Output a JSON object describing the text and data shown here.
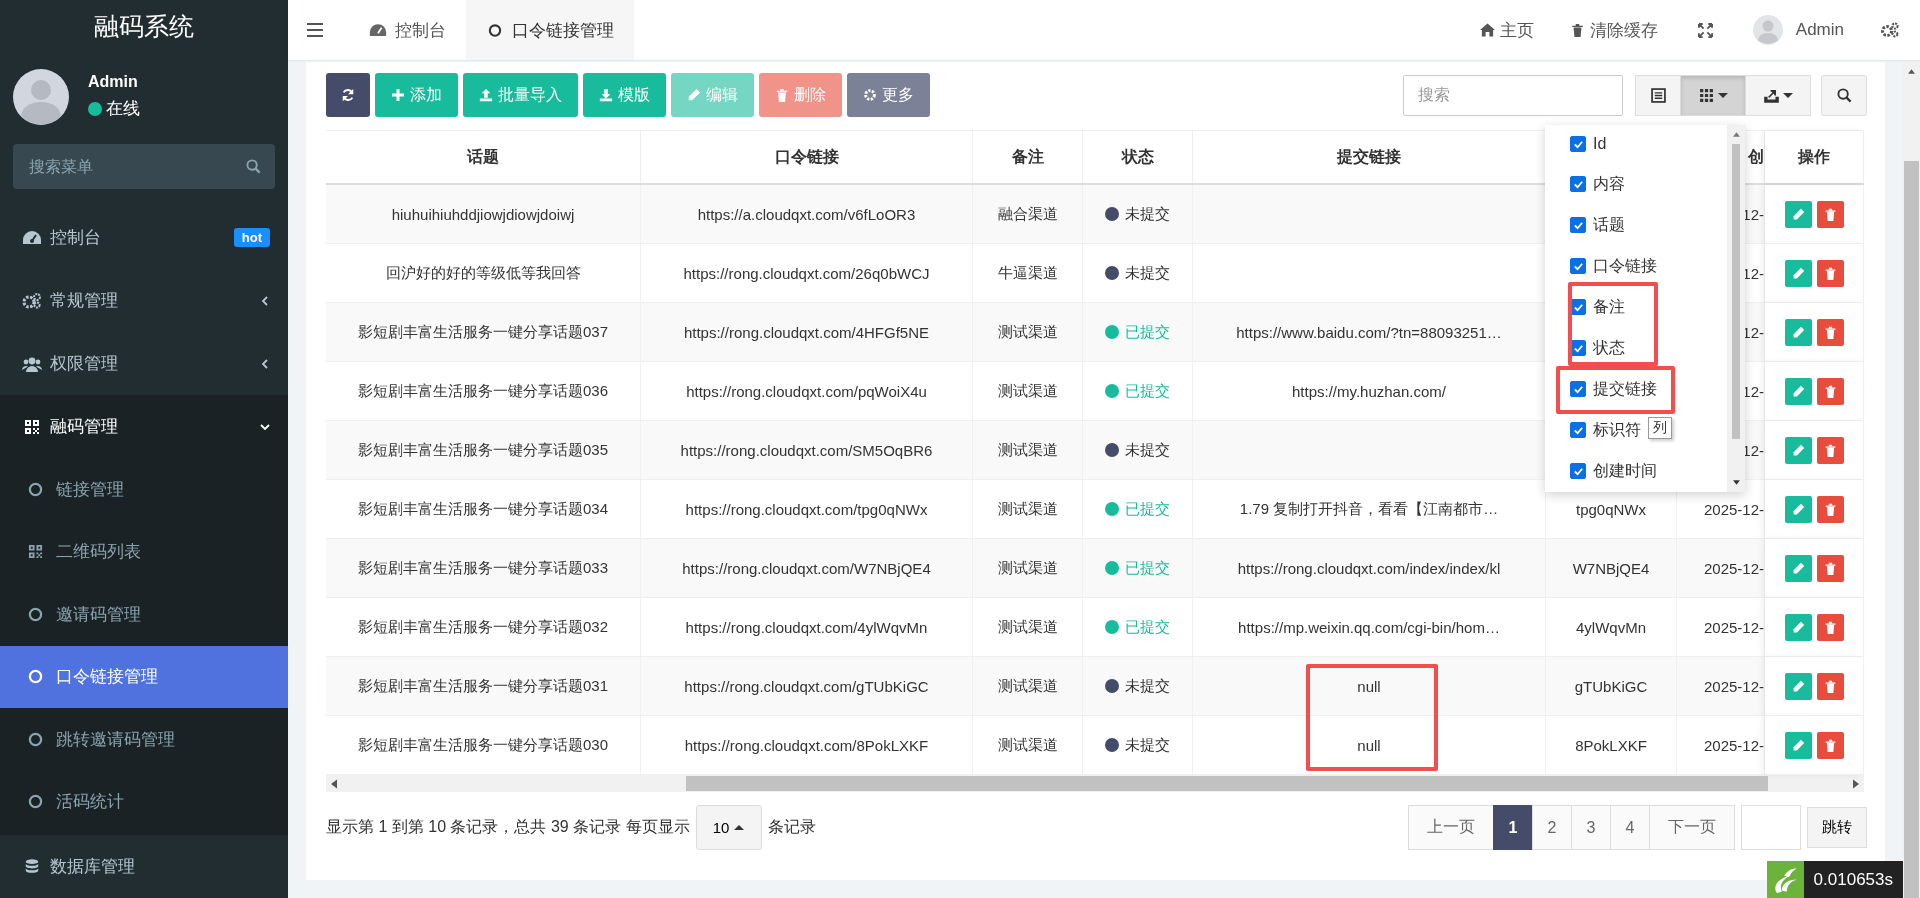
{
  "sidebar": {
    "title": "融码系统",
    "user": {
      "name": "Admin",
      "status": "在线"
    },
    "search": {
      "placeholder": "搜索菜单"
    },
    "items": [
      {
        "label": "控制台",
        "badge": "hot"
      },
      {
        "label": "常规管理",
        "expanded": false
      },
      {
        "label": "权限管理",
        "expanded": false
      },
      {
        "label": "融码管理",
        "expanded": true,
        "children": [
          {
            "label": "链接管理",
            "selected": false
          },
          {
            "label": "二维码列表",
            "selected": false
          },
          {
            "label": "邀请码管理",
            "selected": false
          },
          {
            "label": "口令链接管理",
            "selected": true
          },
          {
            "label": "跳转邀请码管理",
            "selected": false
          },
          {
            "label": "活码统计",
            "selected": false
          }
        ]
      },
      {
        "label": "数据库管理"
      }
    ]
  },
  "header": {
    "tabs": [
      {
        "label": "控制台",
        "selected": false
      },
      {
        "label": "口令链接管理",
        "selected": true
      }
    ],
    "nav": {
      "home": "主页",
      "clear_cache": "清除缓存",
      "user": "Admin"
    }
  },
  "toolbar": {
    "buttons": [
      {
        "kind": "refresh",
        "disabled": false
      },
      {
        "kind": "add",
        "label": "添加",
        "disabled": false
      },
      {
        "kind": "import",
        "label": "批量导入",
        "disabled": false
      },
      {
        "kind": "template",
        "label": "模版",
        "disabled": false
      },
      {
        "kind": "edit",
        "label": "编辑",
        "disabled": true
      },
      {
        "kind": "delete",
        "label": "删除",
        "disabled": true
      },
      {
        "kind": "more",
        "label": "更多",
        "disabled": false
      }
    ],
    "search": {
      "placeholder": "搜索"
    }
  },
  "column_menu": {
    "open": true,
    "tooltip": "列",
    "items": [
      {
        "label": "Id",
        "checked": true
      },
      {
        "label": "内容",
        "checked": true
      },
      {
        "label": "话题",
        "checked": true
      },
      {
        "label": "口令链接",
        "checked": true
      },
      {
        "label": "备注",
        "checked": true
      },
      {
        "label": "状态",
        "checked": true
      },
      {
        "label": "提交链接",
        "checked": true
      },
      {
        "label": "标识符",
        "checked": true
      },
      {
        "label": "创建时间",
        "checked": true
      }
    ]
  },
  "table": {
    "header": {
      "topic": "话题",
      "link": "口令链接",
      "note": "备注",
      "status": "状态",
      "submit_link": "提交链接",
      "created": "创",
      "actions": "操作"
    },
    "rows": [
      {
        "topic": "hiuhuihiuhddjiowjdiowjdoiwj",
        "link": "https://a.cloudqxt.com/v6fLoOR3",
        "note": "融合渠道",
        "status": "未提交",
        "submitted": false,
        "created": "12-"
      },
      {
        "topic": "回沪好的好的等级低等我回答",
        "link": "https://rong.cloudqxt.com/26q0bWCJ",
        "note": "牛逼渠道",
        "status": "未提交",
        "submitted": false,
        "created": "12-"
      },
      {
        "topic": "影短剧丰富生活服务一键分享话题037",
        "link": "https://rong.cloudqxt.com/4HFGf5NE",
        "note": "测试渠道",
        "status": "已提交",
        "submitted": true,
        "submit_link": "https://www.baidu.com/?tn=88093251…",
        "created": "12-"
      },
      {
        "topic": "影短剧丰富生活服务一键分享话题036",
        "link": "https://rong.cloudqxt.com/pqWoiX4u",
        "note": "测试渠道",
        "status": "已提交",
        "submitted": true,
        "submit_link": "https://my.huzhan.com/",
        "created": "12-"
      },
      {
        "topic": "影短剧丰富生活服务一键分享话题035",
        "link": "https://rong.cloudqxt.com/SM5OqBR6",
        "note": "测试渠道",
        "status": "未提交",
        "submitted": false,
        "created": "12-"
      },
      {
        "topic": "影短剧丰富生活服务一键分享话题034",
        "link": "https://rong.cloudqxt.com/tpg0qNWx",
        "note": "测试渠道",
        "status": "已提交",
        "submitted": true,
        "submit_link": "1.79 复制打开抖音，看看【江南都市…",
        "identifier": "tpg0qNWx",
        "created": "2025-12-"
      },
      {
        "topic": "影短剧丰富生活服务一键分享话题033",
        "link": "https://rong.cloudqxt.com/W7NBjQE4",
        "note": "测试渠道",
        "status": "已提交",
        "submitted": true,
        "submit_link": "https://rong.cloudqxt.com/index/index/kl",
        "identifier": "W7NBjQE4",
        "created": "2025-12-"
      },
      {
        "topic": "影短剧丰富生活服务一键分享话题032",
        "link": "https://rong.cloudqxt.com/4ylWqvMn",
        "note": "测试渠道",
        "status": "已提交",
        "submitted": true,
        "submit_link": "https://mp.weixin.qq.com/cgi-bin/hom…",
        "identifier": "4ylWqvMn",
        "created": "2025-12-"
      },
      {
        "topic": "影短剧丰富生活服务一键分享话题031",
        "link": "https://rong.cloudqxt.com/gTUbKiGC",
        "note": "测试渠道",
        "status": "未提交",
        "submitted": false,
        "submit_link": "null",
        "identifier": "gTUbKiGC",
        "created": "2025-12-"
      },
      {
        "topic": "影短剧丰富生活服务一键分享话题030",
        "link": "https://rong.cloudqxt.com/8PokLXKF",
        "note": "测试渠道",
        "status": "未提交",
        "submitted": false,
        "submit_link": "null",
        "identifier": "8PokLXKF",
        "created": "2025-12-"
      }
    ]
  },
  "pagination": {
    "summary": "显示第 1 到第 10 条记录，总共 39 条记录 每页显示",
    "page_size": "10",
    "summary_after": "条记录",
    "prev": "上一页",
    "pages": [
      {
        "label": "1",
        "selected": true
      },
      {
        "label": "2",
        "selected": false
      },
      {
        "label": "3",
        "selected": false
      },
      {
        "label": "4",
        "selected": false
      }
    ],
    "next": "下一页",
    "go": "跳转"
  },
  "debug": {
    "time": "0.010653s"
  }
}
